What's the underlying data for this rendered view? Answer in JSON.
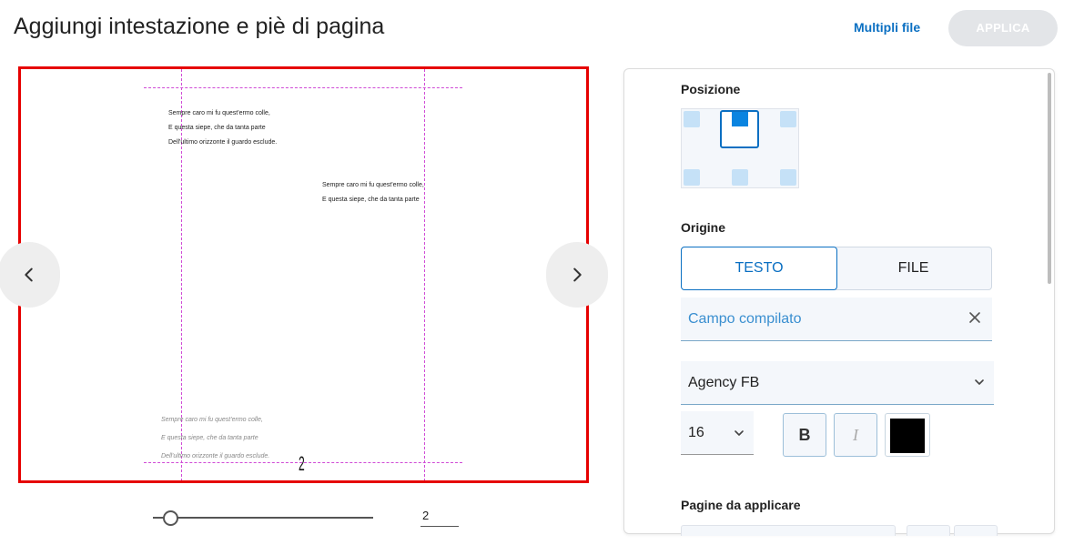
{
  "header": {
    "title": "Aggiungi intestazione e piè di pagina",
    "multi_files_label": "Multipli file",
    "apply_label": "APPLICA"
  },
  "preview": {
    "header_text_left": [
      "Sempre caro mi fu quest'ermo colle,",
      "E questa siepe, che da tanta parte",
      "Dell'ultimo orizzonte il guardo esclude."
    ],
    "header_text_right": [
      "Sempre caro mi fu quest'ermo colle,",
      "E questa siepe, che da tanta parte"
    ],
    "footer_text": [
      "Sempre caro mi fu quest'ermo colle,",
      "E questa siepe, che da tanta parte",
      "Dell'ultimo orizzonte il guardo esclude."
    ],
    "page_number": "2",
    "current_page": "2",
    "zoom_level": 0.08
  },
  "panel": {
    "position_label": "Posizione",
    "origin_label": "Origine",
    "tab_text": "TESTO",
    "tab_file": "FILE",
    "text_field_value": "Campo compilato",
    "font_value": "Agency FB",
    "font_size_value": "16",
    "bold_label": "B",
    "italic_label": "I",
    "text_color": "#000000",
    "pages_label": "Pagine da applicare"
  },
  "colors": {
    "accent": "#0a6fc2",
    "preview_border": "#e60000",
    "guide": "#d04bd6"
  },
  "icons": {
    "prev": "chevron-left-icon",
    "next": "chevron-right-icon",
    "clear": "close-icon",
    "dropdown": "chevron-down-icon"
  }
}
